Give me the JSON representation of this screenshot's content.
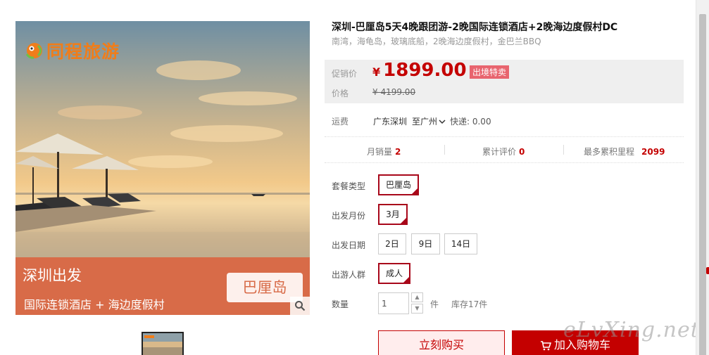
{
  "gallery": {
    "logo_text": "同程旅游",
    "banner_title": "深圳出发",
    "banner_subtitle": "国际连锁酒店 + 海边度假村",
    "destination_badge": "巴厘岛"
  },
  "product": {
    "title": "深圳-巴厘岛5天4晚跟团游-2晚国际连锁酒店+2晚海边度假村DC",
    "subtitle": "南湾，海龟岛，玻璃底船，2晚海边度假村，金巴兰BBQ"
  },
  "price": {
    "promo_label": "促销价",
    "currency": "¥",
    "amount": "1899.00",
    "promo_tag": "出境特卖",
    "orig_label": "价格",
    "orig_price": "¥ 4199.00"
  },
  "shipping": {
    "label": "运费",
    "from": "广东深圳",
    "to": "至广州",
    "fee": "快递: 0.00"
  },
  "stats": {
    "monthly_sales_label": "月销量",
    "monthly_sales": "2",
    "reviews_label": "累计评价",
    "reviews": "0",
    "mileage_label": "最多累积里程",
    "mileage": "2099"
  },
  "options": {
    "package_label": "套餐类型",
    "package_value": "巴厘岛",
    "month_label": "出发月份",
    "month_value": "3月",
    "date_label": "出发日期",
    "dates": [
      "2日",
      "9日",
      "14日"
    ],
    "crowd_label": "出游人群",
    "crowd_value": "成人",
    "qty_label": "数量",
    "qty_value": "1",
    "qty_unit": "件",
    "stock": "库存17件"
  },
  "actions": {
    "buy_now": "立刻购买",
    "add_cart": "加入购物车"
  },
  "watermark": "eLvXing.net",
  "colors": {
    "accent": "#c40000",
    "banner": "#d86b48",
    "logo": "#f07d1a",
    "promo_tag": "#e8646e"
  }
}
